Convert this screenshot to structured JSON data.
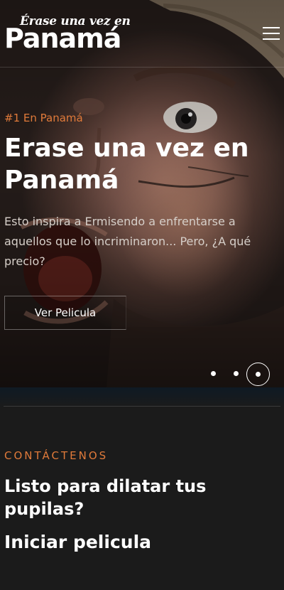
{
  "header": {
    "logo_top": "Érase una vez en",
    "logo_main": "Panamá",
    "menu_icon": "hamburger-menu-icon"
  },
  "hero": {
    "eyebrow": "#1 En Panamá",
    "title": "Erase una vez en Panamá",
    "description": "Esto inspira a Ermisendo a enfrentarse a aquellos que lo incriminaron... Pero, ¿A qué precio?",
    "cta_label": "Ver Pelicula",
    "slides_count": 3,
    "active_slide": 3
  },
  "contact": {
    "eyebrow": "CONTÁCTENOS",
    "title": "Listo para dilatar tus pupilas?",
    "link_label": "Iniciar pelicula"
  },
  "colors": {
    "accent": "#e07a3a",
    "background": "#1b1b1b",
    "text": "#ffffff"
  }
}
